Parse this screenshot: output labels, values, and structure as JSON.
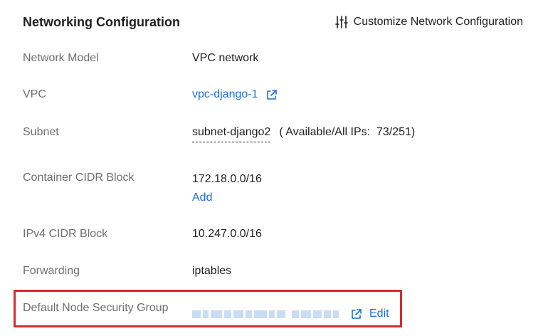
{
  "header": {
    "title": "Networking Configuration",
    "customize_label": "Customize Network Configuration",
    "customize_icon": "sliders-icon"
  },
  "colors": {
    "link": "#1a6fde",
    "highlight_border": "#d9292f",
    "label": "#6f6f6f",
    "text": "#1f1f1f"
  },
  "rows": {
    "network_model": {
      "label": "Network Model",
      "value": "VPC network"
    },
    "vpc": {
      "label": "VPC",
      "value": "vpc-django-1",
      "icon": "external-link-icon"
    },
    "subnet": {
      "label": "Subnet",
      "value": "subnet-django2",
      "info": "( Available/All IPs:  73/251)"
    },
    "container_cidr": {
      "label": "Container CIDR Block",
      "value": "172.18.0.0/16",
      "action": "Add"
    },
    "ipv4_cidr": {
      "label": "IPv4 CIDR Block",
      "value": "10.247.0.0/16"
    },
    "forwarding": {
      "label": "Forwarding",
      "value": "iptables"
    },
    "security_group": {
      "label": "Default Node Security Group",
      "value_state": "blurred",
      "icon": "external-link-icon",
      "action": "Edit"
    }
  }
}
